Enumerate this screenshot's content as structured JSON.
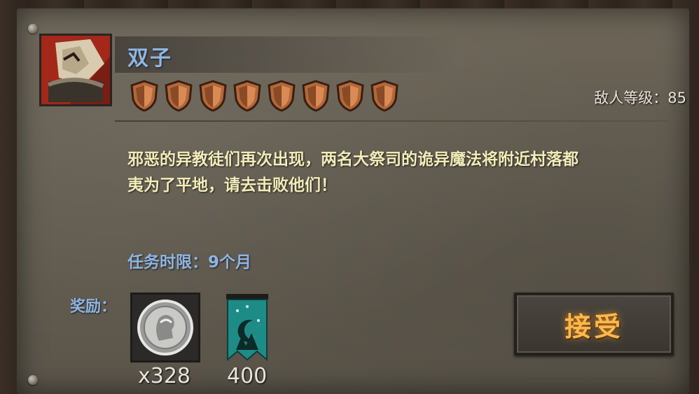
{
  "quest": {
    "name": "双子",
    "enemy_level": "敌人等级：85",
    "difficulty_shield_count": 8,
    "description_line1": "邪恶的异教徒们再次出现，两名大祭司的诡异魔法将附近村落都",
    "description_line2": "夷为了平地，请去击败他们！",
    "time_limit": "任务时限：9个月"
  },
  "rewards": {
    "label": "奖励：",
    "items": [
      {
        "icon": "silver-coin-icon",
        "quantity": "x328"
      },
      {
        "icon": "teal-banner-icon",
        "quantity": "400"
      }
    ]
  },
  "actions": {
    "accept_label": "接受"
  },
  "colors": {
    "title_blue": "#8fb5e3",
    "description_yellow": "#f4ecb8",
    "accept_orange": "#ffb84a",
    "shield_bronze": "#b2683a"
  }
}
